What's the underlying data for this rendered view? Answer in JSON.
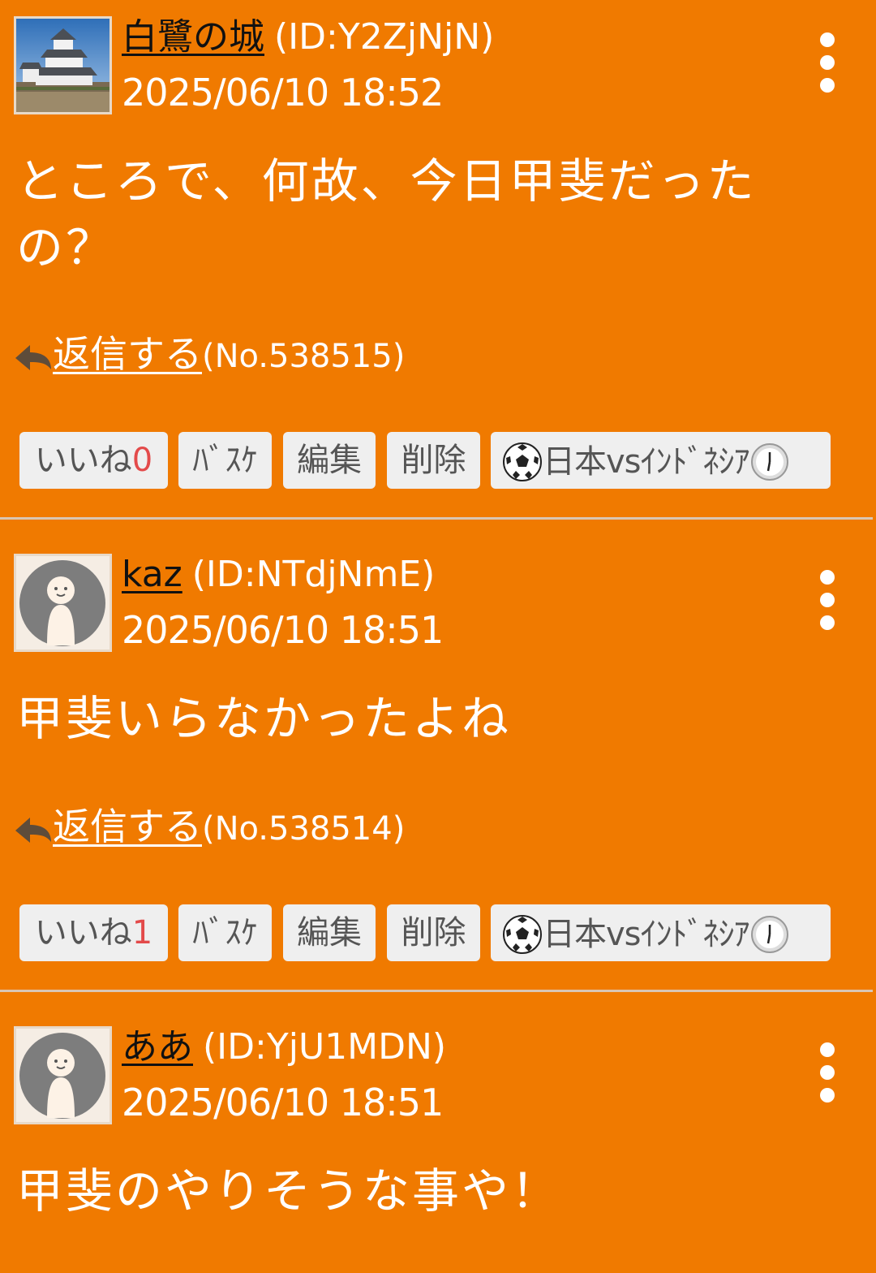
{
  "posts": [
    {
      "username": "白鷺の城",
      "user_id": "(ID:Y2ZjNjN)",
      "datetime": "2025/06/10 18:52",
      "avatar": "castle-photo",
      "body": "ところで、何故、今日甲斐だったの？",
      "reply_label": "返信する",
      "post_no": "(No.538515)",
      "like_label": "いいね",
      "like_count": "0",
      "buttons": [
        "ﾊﾞｽｹ",
        "編集",
        "削除"
      ],
      "topic_label": "日本vsｲﾝﾄﾞﾈｼｱ",
      "topic_icons": [
        "soccer-ball-icon",
        "clock-icon"
      ]
    },
    {
      "username": "kaz",
      "user_id": "(ID:NTdjNmE)",
      "datetime": "2025/06/10 18:51",
      "avatar": "default-person",
      "body": "甲斐いらなかったよね",
      "reply_label": "返信する",
      "post_no": "(No.538514)",
      "like_label": "いいね",
      "like_count": "1",
      "buttons": [
        "ﾊﾞｽｹ",
        "編集",
        "削除"
      ],
      "topic_label": "日本vsｲﾝﾄﾞﾈｼｱ",
      "topic_icons": [
        "soccer-ball-icon",
        "clock-icon"
      ]
    },
    {
      "username": "ああ",
      "user_id": "(ID:YjU1MDN)",
      "datetime": "2025/06/10 18:51",
      "avatar": "default-person",
      "body": "甲斐のやりそうな事や！"
    }
  ],
  "colors": {
    "background": "#f07a00",
    "username": "#111111",
    "button_bg": "#efefef",
    "button_text": "#555555",
    "like_count": "#e34a4a"
  },
  "icons": {
    "menu": "more-vertical-icon",
    "reply": "reply-arrow-icon"
  }
}
